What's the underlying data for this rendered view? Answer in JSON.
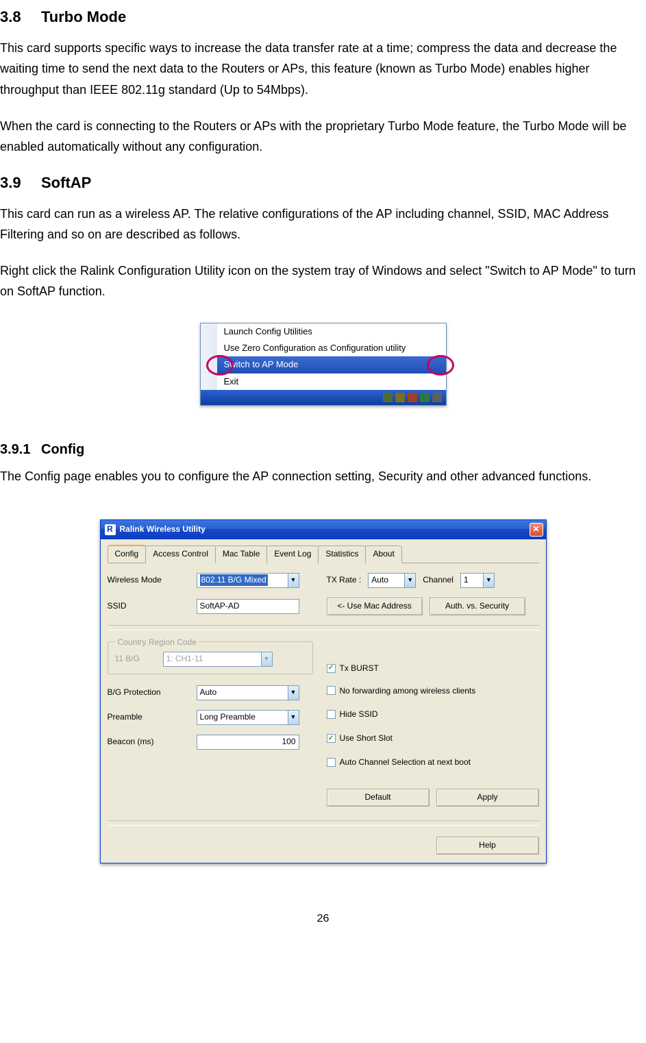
{
  "section38": {
    "num": "3.8",
    "title": "Turbo Mode",
    "p1": "This card supports specific ways to increase the data transfer rate at a time; compress the data and decrease the waiting time to send the next data to the Routers or APs, this feature (known as Turbo Mode) enables higher throughput than IEEE 802.11g standard (Up to 54Mbps).",
    "p2": "When the card is connecting to the Routers or APs with the proprietary Turbo Mode feature, the Turbo Mode will be enabled automatically without any configuration."
  },
  "section39": {
    "num": "3.9",
    "title": "SoftAP",
    "p1": "This card can run as a wireless AP. The relative configurations of the AP including channel, SSID, MAC Address Filtering and so on are described as follows.",
    "p2": "Right click the Ralink Configuration Utility icon on the system tray of Windows and select \"Switch to AP Mode\" to turn on SoftAP function."
  },
  "tray_menu": {
    "items": [
      "Launch Config Utilities",
      "Use Zero Configuration as Configuration utility",
      "Switch to AP Mode",
      "Exit"
    ]
  },
  "section391": {
    "num": "3.9.1",
    "title": "Config",
    "p1": "The Config page enables you to configure the AP connection setting, Security and other advanced functions."
  },
  "dialog": {
    "title": "Ralink Wireless Utility",
    "tabs": [
      "Config",
      "Access Control",
      "Mac Table",
      "Event Log",
      "Statistics",
      "About"
    ],
    "labels": {
      "wireless_mode": "Wireless Mode",
      "tx_rate": "TX Rate :",
      "channel": "Channel",
      "ssid": "SSID",
      "use_mac": "<- Use Mac Address",
      "auth_sec": "Auth. vs. Security",
      "country_group": "Country Region Code",
      "bg11": "11 B/G",
      "tx_burst": "Tx BURST",
      "bg_prot": "B/G Protection",
      "no_fwd": "No forwarding among wireless clients",
      "preamble": "Preamble",
      "hide_ssid": "Hide SSID",
      "beacon": "Beacon (ms)",
      "short_slot": "Use Short Slot",
      "auto_chan": "Auto Channel Selection at next boot",
      "default": "Default",
      "apply": "Apply",
      "help": "Help"
    },
    "values": {
      "wireless_mode": "802.11 B/G Mixed",
      "tx_rate": "Auto",
      "channel": "1",
      "ssid": "SoftAP-AD",
      "country": "1: CH1-11",
      "bg_prot": "Auto",
      "preamble": "Long Preamble",
      "beacon": "100"
    }
  },
  "page_number": "26"
}
